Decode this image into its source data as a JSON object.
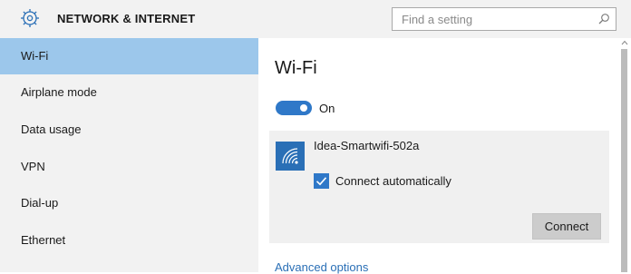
{
  "header": {
    "section_title": "NETWORK & INTERNET",
    "search_placeholder": "Find a setting"
  },
  "sidebar": {
    "items": [
      {
        "label": "Wi-Fi",
        "selected": true
      },
      {
        "label": "Airplane mode",
        "selected": false
      },
      {
        "label": "Data usage",
        "selected": false
      },
      {
        "label": "VPN",
        "selected": false
      },
      {
        "label": "Dial-up",
        "selected": false
      },
      {
        "label": "Ethernet",
        "selected": false
      }
    ]
  },
  "main": {
    "title": "Wi-Fi",
    "wifi_toggle": {
      "state": "On",
      "enabled": true
    },
    "network": {
      "name": "Idea-Smartwifi-502a",
      "connect_automatically": {
        "label": "Connect automatically",
        "checked": true
      },
      "connect_button": "Connect"
    },
    "advanced_options": "Advanced options"
  },
  "icons": {
    "settings": "gear-icon",
    "search": "search-icon",
    "network": "wifi-signal-icon",
    "checkbox": "checkmark-icon"
  },
  "colors": {
    "accent": "#2f78c8",
    "selected_nav": "#9cc7eb",
    "panel_background": "#f2f2f2",
    "link": "#2a6fb6"
  }
}
